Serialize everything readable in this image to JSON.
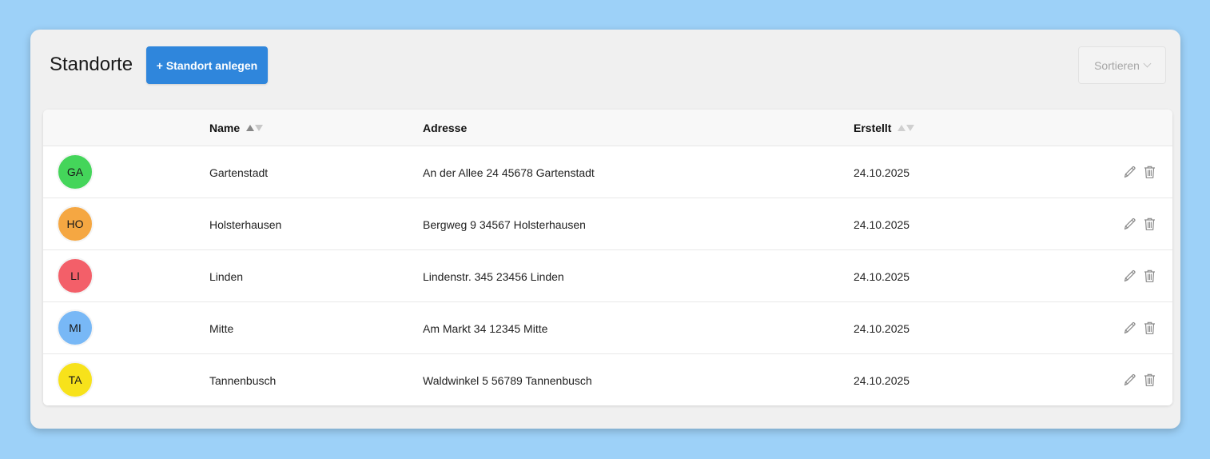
{
  "header": {
    "title": "Standorte",
    "add_button_label": "+ Standort anlegen",
    "sort_select": {
      "label": "Sortieren",
      "icon": "chevron-down-icon"
    }
  },
  "table": {
    "columns": [
      {
        "key": "avatar",
        "label": ""
      },
      {
        "key": "name",
        "label": "Name",
        "sortable": true,
        "sort_state": "ascending"
      },
      {
        "key": "address",
        "label": "Adresse",
        "sortable": false
      },
      {
        "key": "created",
        "label": "Erstellt",
        "sortable": true,
        "sort_state": "none"
      }
    ],
    "rows": [
      {
        "initials": "GA",
        "color": "#44d55a",
        "name": "Gartenstadt",
        "address": "An der Allee 24 45678 Gartenstadt",
        "created": "24.10.2025"
      },
      {
        "initials": "HO",
        "color": "#f5a742",
        "name": "Holsterhausen",
        "address": "Bergweg 9 34567 Holsterhausen",
        "created": "24.10.2025"
      },
      {
        "initials": "LI",
        "color": "#f35f69",
        "name": "Linden",
        "address": "Lindenstr. 345 23456 Linden",
        "created": "24.10.2025"
      },
      {
        "initials": "MI",
        "color": "#78b8f6",
        "name": "Mitte",
        "address": "Am Markt 34 12345 Mitte",
        "created": "24.10.2025"
      },
      {
        "initials": "TA",
        "color": "#f7e21b",
        "name": "Tannenbusch",
        "address": "Waldwinkel 5 56789 Tannenbusch",
        "created": "24.10.2025"
      }
    ],
    "row_actions": [
      "pencil-icon",
      "trash-icon"
    ]
  },
  "colors": {
    "background": "#9dd1f8",
    "panel": "#f0f0f0",
    "primary": "#2f86dc"
  }
}
